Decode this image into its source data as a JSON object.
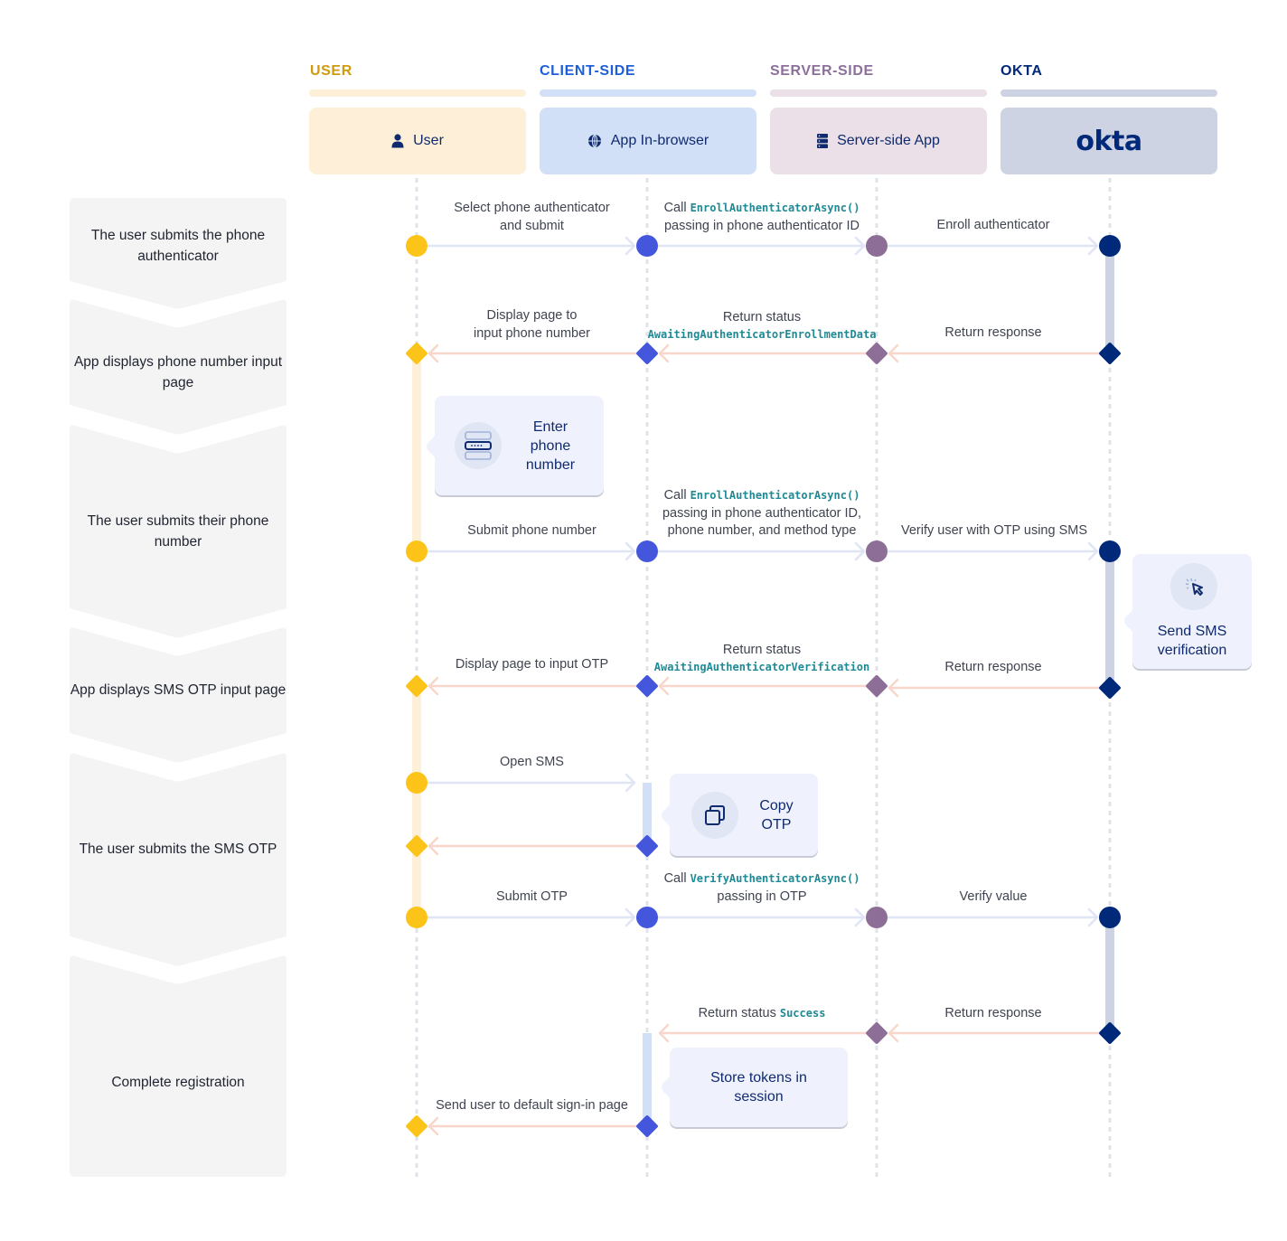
{
  "lanes": [
    {
      "id": "user",
      "title": "USER",
      "label": "User",
      "icon": "user-icon",
      "title_color": "#d19a0a",
      "bar_color": "#fef0d8",
      "box_color": "#fef0d8",
      "node_color": "#fcc419",
      "activation_color": "#fef0d8"
    },
    {
      "id": "client",
      "title": "CLIENT-SIDE",
      "label": "App In-browser",
      "icon": "globe-icon",
      "title_color": "#1e5fd9",
      "bar_color": "#d2e0f7",
      "box_color": "#d2e0f7",
      "node_color": "#4457dc",
      "activation_color": "#d2e0f7"
    },
    {
      "id": "server",
      "title": "SERVER-SIDE",
      "label": "Server-side App",
      "icon": "server-icon",
      "title_color": "#8c6f9b",
      "bar_color": "#ebe0e7",
      "box_color": "#ebe0e7",
      "node_color": "#8d6e97",
      "activation_color": "#ebe0e7"
    },
    {
      "id": "okta",
      "title": "OKTA",
      "label": "okta",
      "icon": "okta-logo",
      "title_color": "#00297a",
      "bar_color": "#cdd3e2",
      "box_color": "#cdd3e2",
      "node_color": "#00297a",
      "activation_color": "#cdd3e2"
    }
  ],
  "stages": [
    {
      "label": "The user submits the phone authenticator"
    },
    {
      "label": "App displays phone number input page"
    },
    {
      "label": "The user submits their phone number"
    },
    {
      "label": "App displays SMS OTP input page"
    },
    {
      "label": "The user submits the SMS OTP"
    },
    {
      "label": "Complete registration"
    }
  ],
  "messages": [
    {
      "from": "user",
      "to": "client",
      "dir": "request",
      "text": [
        "Select phone authenticator",
        "and submit"
      ]
    },
    {
      "from": "client",
      "to": "server",
      "dir": "request",
      "prefix": "Call ",
      "code": "EnrollAuthenticatorAsync()",
      "text": [
        "passing in phone authenticator ID"
      ]
    },
    {
      "from": "server",
      "to": "okta",
      "dir": "request",
      "text": [
        "Enroll authenticator"
      ]
    },
    {
      "from": "client",
      "to": "user",
      "dir": "response",
      "text": [
        "Display page to",
        "input phone number"
      ]
    },
    {
      "from": "server",
      "to": "client",
      "dir": "response",
      "prefix": "Return status",
      "code": "AwaitingAuthenticatorEnrollmentData",
      "text": []
    },
    {
      "from": "okta",
      "to": "server",
      "dir": "response",
      "text": [
        "Return response"
      ]
    },
    {
      "from": "user",
      "to": "client",
      "dir": "request",
      "text": [
        "Submit phone number"
      ]
    },
    {
      "from": "client",
      "to": "server",
      "dir": "request",
      "prefix": "Call ",
      "code": "EnrollAuthenticatorAsync()",
      "text": [
        "passing in phone authenticator ID,",
        "phone number, and method type"
      ]
    },
    {
      "from": "server",
      "to": "okta",
      "dir": "request",
      "text": [
        "Verify user with OTP using SMS"
      ]
    },
    {
      "from": "client",
      "to": "user",
      "dir": "response",
      "text": [
        "Display page to input OTP"
      ]
    },
    {
      "from": "server",
      "to": "client",
      "dir": "response",
      "prefix": "Return status",
      "code": "AwaitingAuthenticatorVerification",
      "text": []
    },
    {
      "from": "okta",
      "to": "server",
      "dir": "response",
      "text": [
        "Return response"
      ]
    },
    {
      "from": "user",
      "to": "client",
      "dir": "request",
      "text": [
        "Open SMS"
      ]
    },
    {
      "from": "client",
      "to": "user",
      "dir": "response",
      "text": []
    },
    {
      "from": "user",
      "to": "client",
      "dir": "request",
      "text": [
        "Submit OTP"
      ]
    },
    {
      "from": "client",
      "to": "server",
      "dir": "request",
      "prefix": "Call ",
      "code": "VerifyAuthenticatorAsync()",
      "text": [
        "passing in OTP"
      ]
    },
    {
      "from": "server",
      "to": "okta",
      "dir": "request",
      "text": [
        "Verify value"
      ]
    },
    {
      "from": "server",
      "to": "client",
      "dir": "response",
      "prefix": "Return status ",
      "code": "Success",
      "text": []
    },
    {
      "from": "okta",
      "to": "server",
      "dir": "response",
      "text": [
        "Return response"
      ]
    },
    {
      "from": "client",
      "to": "user",
      "dir": "response",
      "text": [
        "Send user to default sign-in page"
      ]
    }
  ],
  "notes": [
    {
      "label": "Enter phone number",
      "lines": [
        "Enter",
        "phone",
        "number"
      ],
      "icon": "form-input-icon"
    },
    {
      "label": "Send SMS verification",
      "lines": [
        "Send SMS",
        "verification"
      ],
      "icon": "cursor-click-icon"
    },
    {
      "label": "Copy OTP",
      "lines": [
        "Copy",
        "OTP"
      ],
      "icon": "copy-icon"
    },
    {
      "label": "Store tokens in session",
      "lines": [
        "Store tokens in",
        "session"
      ],
      "icon": ""
    }
  ],
  "colors": {
    "request_arrow": "#dfe5f5",
    "response_arrow": "#f8d6cc",
    "lifeline": "#dfe3ea",
    "stage_bg": "#f4f4f4",
    "code": "#1f8a95"
  }
}
